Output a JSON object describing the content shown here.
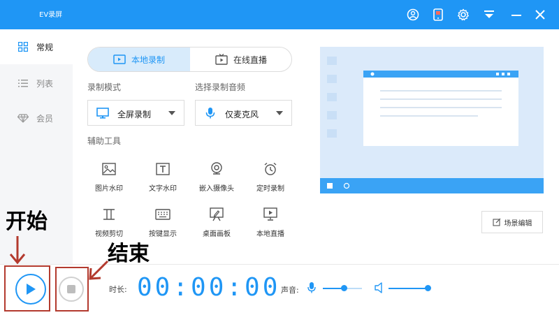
{
  "app": {
    "title": "EV录屏"
  },
  "titlebar_icons": [
    "user-icon",
    "phone-icon",
    "gear-icon",
    "download-icon",
    "minimize-icon",
    "close-icon"
  ],
  "sidebar": {
    "items": [
      {
        "label": "常规",
        "icon": "grid-icon",
        "active": true
      },
      {
        "label": "列表",
        "icon": "list-icon",
        "active": false
      },
      {
        "label": "会员",
        "icon": "diamond-icon",
        "active": false
      }
    ]
  },
  "mode_tabs": [
    {
      "label": "本地录制",
      "icon": "record-icon",
      "active": true
    },
    {
      "label": "在线直播",
      "icon": "tv-icon",
      "active": false
    }
  ],
  "record_mode": {
    "label": "录制模式",
    "selected": "全屏录制",
    "icon": "monitor-icon"
  },
  "audio_source": {
    "label": "选择录制音频",
    "selected": "仅麦克风",
    "icon": "mic-icon"
  },
  "tools": {
    "label": "辅助工具",
    "items": [
      {
        "label": "图片水印",
        "icon": "image-icon"
      },
      {
        "label": "文字水印",
        "icon": "text-icon"
      },
      {
        "label": "嵌入摄像头",
        "icon": "webcam-icon"
      },
      {
        "label": "定时录制",
        "icon": "alarm-icon"
      },
      {
        "label": "视频剪切",
        "icon": "crop-icon"
      },
      {
        "label": "按键显示",
        "icon": "keyboard-icon"
      },
      {
        "label": "桌面画板",
        "icon": "pen-board-icon"
      },
      {
        "label": "本地直播",
        "icon": "screen-play-icon"
      }
    ]
  },
  "scene_edit": {
    "label": "场景编辑",
    "icon": "edit-icon"
  },
  "controls": {
    "duration_label": "时长:",
    "timer": "00:00:00",
    "volume_label": "声音:",
    "mic_volume": 0.55,
    "speaker_volume": 1.0
  },
  "annotations": {
    "start": "开始",
    "stop": "结束"
  },
  "colors": {
    "accent": "#1f96f5",
    "annotation": "#b33a2e"
  }
}
